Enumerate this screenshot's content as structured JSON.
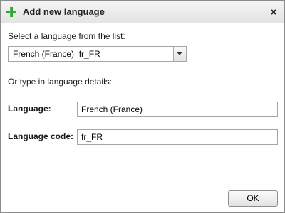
{
  "dialog": {
    "title": "Add new language",
    "icon": "plus-icon",
    "close_icon": "close-icon",
    "accent_color": "#2fa82f"
  },
  "select_section": {
    "prompt": "Select a language from the list:",
    "selected_value": "French (France)  fr_FR",
    "dropdown_icon": "chevron-down-icon"
  },
  "details_section": {
    "prompt": "Or type in language details:",
    "language_label": "Language:",
    "language_value": "French (France)",
    "code_label": "Language code:",
    "code_value": "fr_FR"
  },
  "buttons": {
    "ok_label": "OK"
  }
}
